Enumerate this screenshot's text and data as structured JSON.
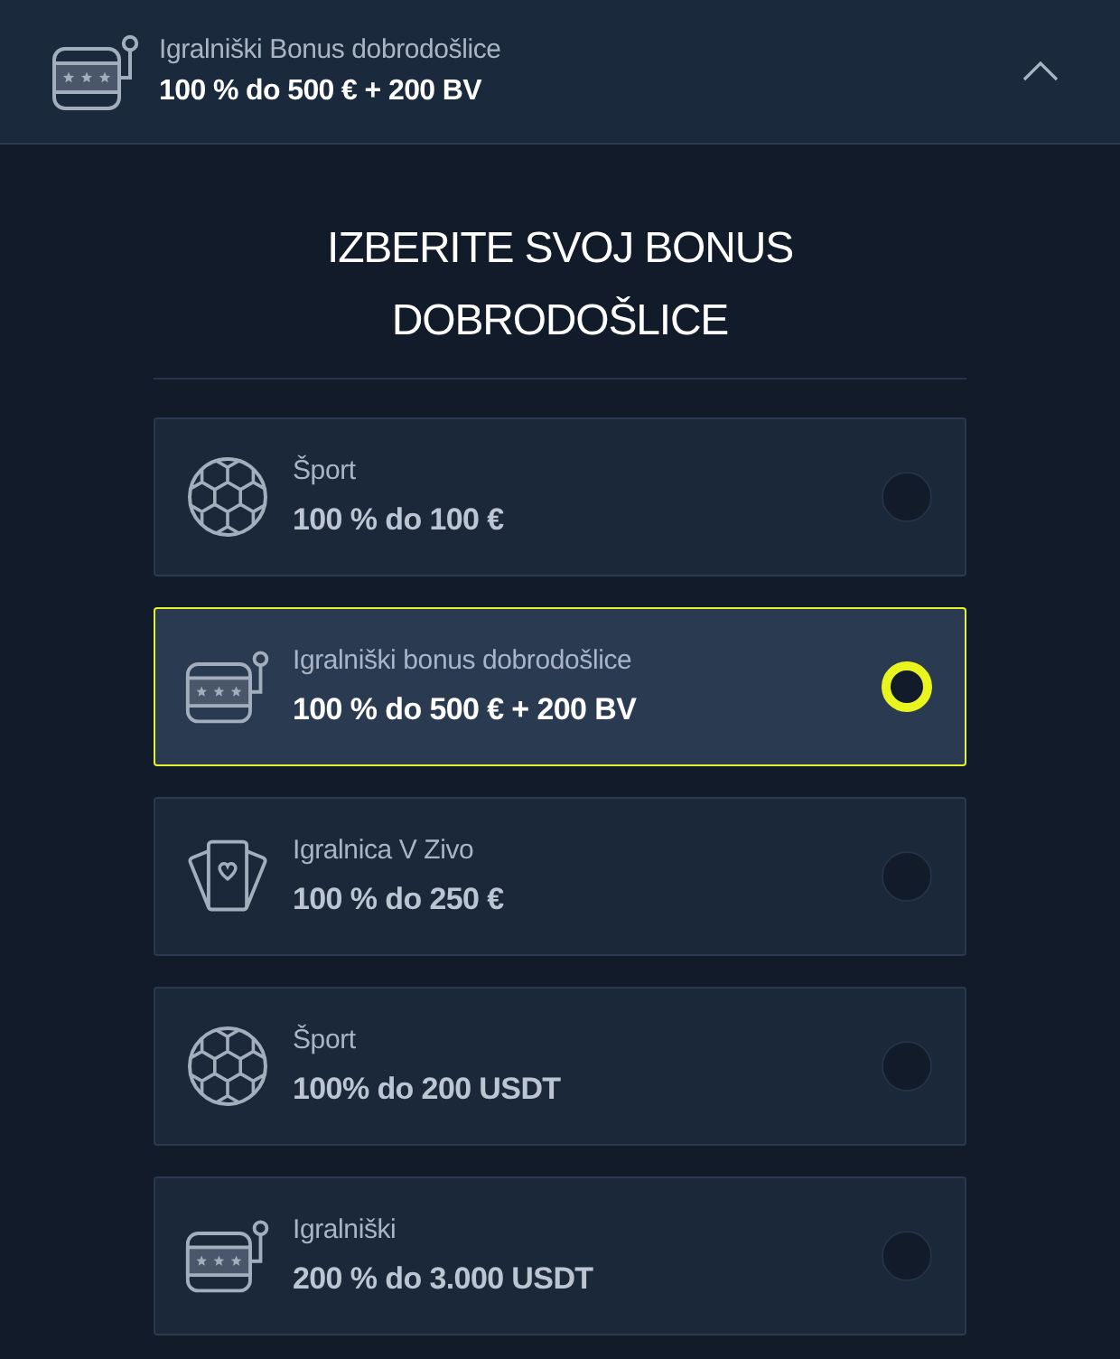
{
  "header": {
    "kind": "slot",
    "label": "Igralniški Bonus dobrodošlice",
    "amount": "100 % do 500 € + 200 BV",
    "expanded": true
  },
  "title": "IZBERITE SVOJ BONUS DOBRODOŠLICE",
  "options": [
    {
      "kind": "ball",
      "label": "Šport",
      "amount": "100 % do 100 €",
      "selected": false
    },
    {
      "kind": "slot",
      "label": "Igralniški bonus dobrodošlice",
      "amount": "100 % do 500 € + 200 BV",
      "selected": true
    },
    {
      "kind": "cards",
      "label": "Igralnica V Zivo",
      "amount": "100 % do 250 €",
      "selected": false
    },
    {
      "kind": "ball",
      "label": "Šport",
      "amount": "100% do 200 USDT",
      "selected": false
    },
    {
      "kind": "slot",
      "label": "Igralniški",
      "amount": "200 % do 3.000 USDT",
      "selected": false
    }
  ]
}
